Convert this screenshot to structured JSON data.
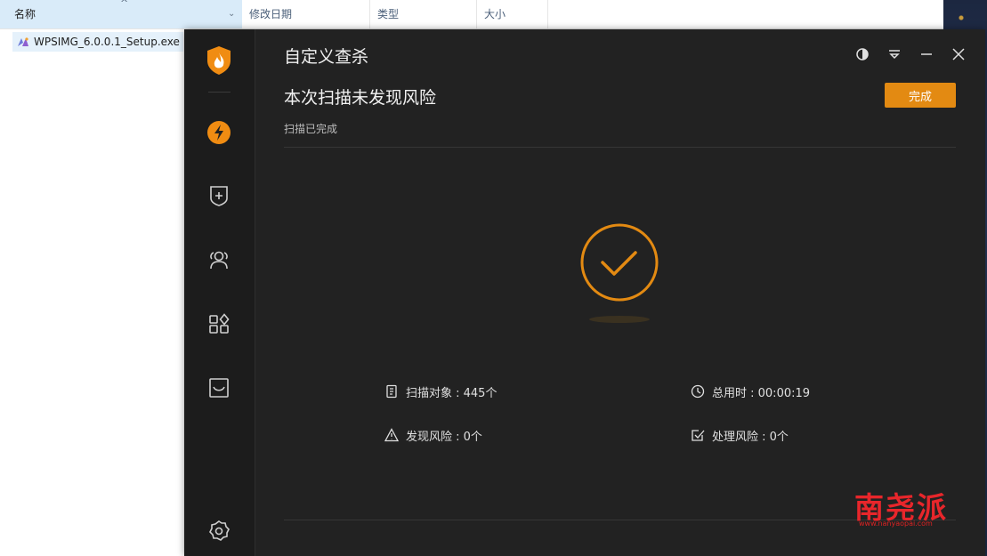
{
  "explorer": {
    "columns": {
      "name": "名称",
      "modified": "修改日期",
      "type": "类型",
      "size": "大小"
    },
    "file": "WPSIMG_6.0.0.1_Setup.exe"
  },
  "window": {
    "title": "自定义查杀",
    "headline": "本次扫描未发现风险",
    "subtext": "扫描已完成",
    "done_label": "完成",
    "accent": "#e38a12"
  },
  "stats": {
    "scanned": "扫描对象 : 445个",
    "duration": "总用时 : 00:00:19",
    "risks_found": "发现风险 : 0个",
    "risks_handled": "处理风险 : 0个"
  },
  "sidebar_icons": [
    "flame-shield-logo",
    "lightning-icon",
    "shield-plus-icon",
    "users-icon",
    "apps-icon",
    "inbox-icon",
    "settings-icon"
  ],
  "watermark": {
    "text": "南尧派",
    "url": "www.nanyaopai.com"
  }
}
